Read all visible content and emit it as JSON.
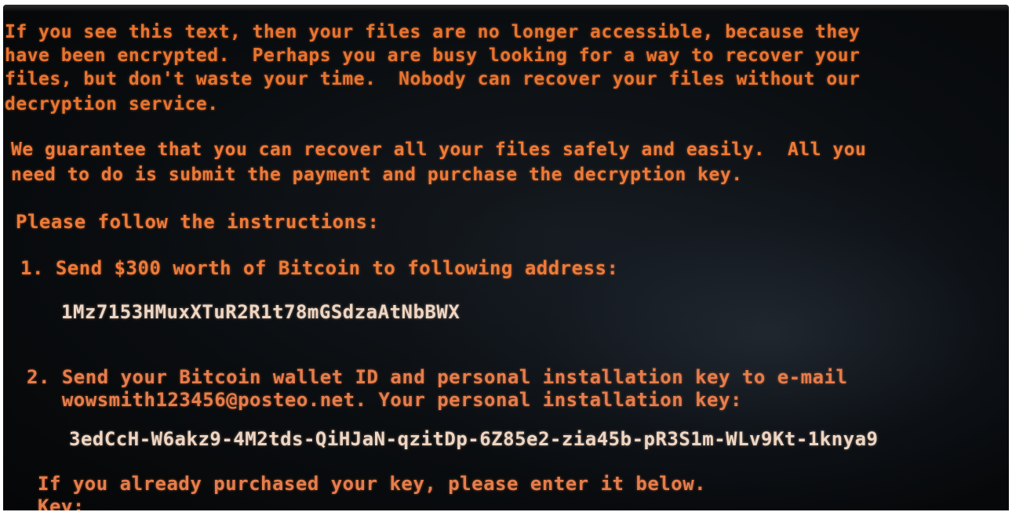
{
  "message": {
    "intro": [
      "If you see this text, then your files are no longer accessible, because they",
      "have been encrypted.  Perhaps you are busy looking for a way to recover your",
      "files, but don't waste your time.  Nobody can recover your files without our",
      "decryption service."
    ],
    "guarantee": [
      "We guarantee that you can recover all your files safely and easily.  All you",
      "need to do is submit the payment and purchase the decryption key."
    ],
    "instructions_heading": "Please follow the instructions:",
    "step1": "1. Send $300 worth of Bitcoin to following address:",
    "bitcoin_address": "1Mz7153HMuxXTuR2R1t78mGSdzaAtNbBWX",
    "step2": [
      "2. Send your Bitcoin wallet ID and personal installation key to e-mail",
      "   wowsmith123456@posteo.net. Your personal installation key:"
    ],
    "installation_key": "3edCcH-W6akz9-4M2tds-QiHJaN-qzitDp-6Z85e2-zia45b-pR3S1m-WLv9Kt-1knya9",
    "purchased_prompt": "If you already purchased your key, please enter it below.",
    "key_label": "Key:"
  },
  "colors": {
    "text_orange": "#e8742f",
    "text_cream": "#efd6c2",
    "screen_background": "#0a0d10"
  }
}
